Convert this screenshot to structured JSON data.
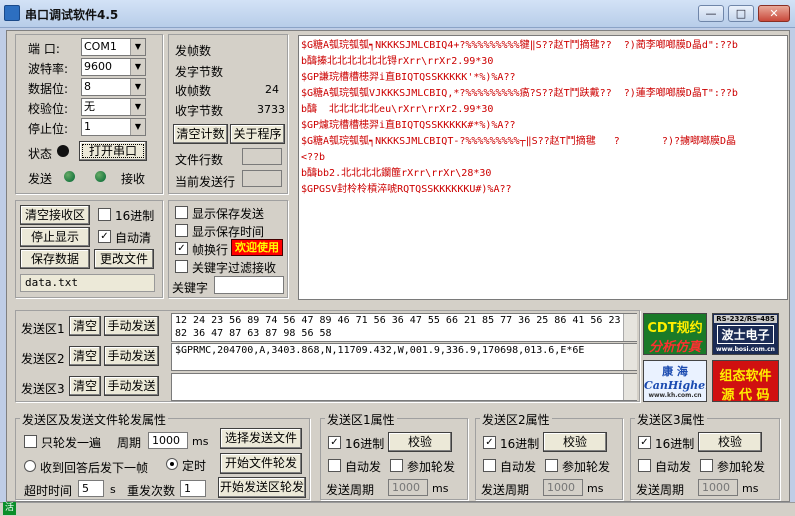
{
  "window": {
    "title": "串口调试软件4.5",
    "min_glyph": "—",
    "max_glyph": "□",
    "close_glyph": "✕"
  },
  "serial": {
    "port_label": "端  口:",
    "port_value": "COM1",
    "baud_label": "波特率:",
    "baud_value": "9600",
    "data_label": "数据位:",
    "data_value": "8",
    "parity_label": "校验位:",
    "parity_value": "无",
    "stop_label": "停止位:",
    "stop_value": "1",
    "status_label": "状态",
    "open_button": "打开串口",
    "send_label": "发送",
    "recv_label": "接收"
  },
  "stats": {
    "frames_label": "发帧数",
    "send_bytes_label": "发字节数",
    "recv_frames_label": "收帧数",
    "recv_frames_value": "24",
    "recv_bytes_label": "收字节数",
    "recv_bytes_value": "3733",
    "clear_count_button": "清空计数",
    "about_button": "关于程序",
    "file_lines_label": "文件行数",
    "current_line_label": "当前发送行"
  },
  "recv_controls": {
    "clear_button": "清空接收区",
    "hex_label": "16进制",
    "hex_checked": "",
    "stop_display_button": "停止显示",
    "auto_clear_label": "自动清",
    "auto_clear_checked": "✓",
    "save_button": "保存数据",
    "change_file_button": "更改文件",
    "filename": "data.txt"
  },
  "display_opts": {
    "show_save_send": "显示保存发送",
    "show_save_time": "显示保存时间",
    "frame_newline": "帧换行",
    "frame_newline_checked": "✓",
    "badge": "欢迎使用",
    "keyword_filter": "关键字过滤接收",
    "keyword_label": "关键字",
    "keyword_value": ""
  },
  "recv_lines": [
    "$G糖A瓠琓瓠瓠┑NKKKSJMLCBIQ4+?%%%%%%%%%犍‖S??赵T鬥摘毽??  ?)蔺李啷啷膜D晶d\":??b",
    "b醻搸北北北北北北锝rXrr\\rrXr2.99*30",
    "$GP謙琓槽槽槵羿i直BIQTQSSKKKKK'*%)%A??",
    "$G糖A瓠琓瓠瓠VJKKKSJMLCBIQ,*?%%%%%%%%%瘑?S??赵T鬥趺戴??  ?)蓮李啷啷膜D晶T\":??b",
    "b醻  北北北北北eu\\rXrr\\rrXr2.99*30",
    "$GP爈琓槽槽槵羿i直BIQTQSSKKKKK#*%)%A??",
    "$G糖A瓠琓瓠瓠┑NKKKSJMLCBIQT-?%%%%%%%%%┬‖S??赵T鬥摘毽   ?       ?)?擄啷啷膜D晶",
    "<??b",
    "b醻bb2.北北北北鑭篚rXrr\\rrXr\\28*30",
    "$GPGSV封柃柃槓淬唬RQTQSSKKKKKKU#)%A??"
  ],
  "send_area": {
    "area1_label": "发送区1",
    "area2_label": "发送区2",
    "area3_label": "发送区3",
    "clear": "清空",
    "manual_send": "手动发送",
    "area1_text": "12 24 23 56 89 74 56 47 89 46 71 56 36 47 55 66 21 85 77 36 25 86 41 56 23\n82 36 47 87 63 87 98 56 58",
    "area2_text": "$GPRMC,204700,A,3403.868,N,11709.432,W,001.9,336.9,170698,013.6,E*6E",
    "area3_text": ""
  },
  "logos": {
    "cdt_line1": "CDT规约",
    "cdt_line2": "分析仿真",
    "rs_top": "RS-232/RS-485",
    "rs_main": "波士电子",
    "rs_url": "www.bosi.com.cn",
    "kh_line1": "康 海",
    "kh_line2": "CanHigher",
    "kh_url": "www.kh.com.cn",
    "src_line1": "组态软件",
    "src_line2": "源 代 码"
  },
  "send_props": {
    "title": "发送区及发送文件轮发属性",
    "once_label": "只轮发一遍",
    "period_label": "周期",
    "period_value": "1000",
    "ms": "ms",
    "choose_file_button": "选择发送文件",
    "reply_label": "收到回答后发下一帧",
    "timed_label": "定时",
    "start_file_button": "开始文件轮发",
    "timeout_label": "超时时间",
    "timeout_value": "5",
    "s": "s",
    "repeat_label": "重发次数",
    "repeat_value": "1",
    "start_area_button": "开始发送区轮发"
  },
  "area_props": [
    {
      "title": "发送区1属性",
      "hex": "16进制",
      "verify": "校验",
      "auto": "自动发",
      "join": "参加轮发",
      "period": "发送周期",
      "period_value": "1000",
      "ms": "ms"
    },
    {
      "title": "发送区2属性",
      "hex": "16进制",
      "verify": "校验",
      "auto": "自动发",
      "join": "参加轮发",
      "period": "发送周期",
      "period_value": "1000",
      "ms": "ms"
    },
    {
      "title": "发送区3属性",
      "hex": "16进制",
      "verify": "校验",
      "auto": "自动发",
      "join": "参加轮发",
      "period": "发送周期",
      "period_value": "1000",
      "ms": "ms"
    }
  ],
  "statusbar": {
    "icon_text": "活"
  },
  "colors": {
    "recv_text": "#cc0000",
    "badge_bg": "#ff0000",
    "badge_fg": "#ffff00"
  }
}
